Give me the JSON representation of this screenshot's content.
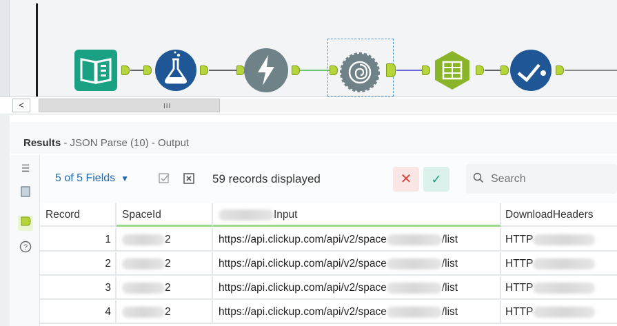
{
  "canvas": {
    "colors": {
      "book_tool": "#1aa083",
      "blue_tool": "#1f5796",
      "grey_tool": "#6f8288",
      "summarize_tool": "#8ab52a",
      "anchor": "#b5d53a",
      "selection": "#4a90c7"
    },
    "tools": [
      {
        "name": "input-data-icon",
        "color": "#1aa083"
      },
      {
        "name": "formula-icon",
        "color": "#1f5796"
      },
      {
        "name": "download-icon",
        "color": "#6f8288"
      },
      {
        "name": "json-parse-icon",
        "color": "#6f8288"
      },
      {
        "name": "summarize-icon",
        "color": "#8ab52a"
      },
      {
        "name": "browse-icon",
        "color": "#1f5796"
      }
    ]
  },
  "scrollbar": {
    "left_arrow": "<",
    "grip": "III"
  },
  "results": {
    "label": "Results",
    "title": " - JSON Parse (10) - Output",
    "fields_label": "5 of 5 Fields",
    "records_displayed": "59 records displayed",
    "search_placeholder": "Search",
    "columns": [
      "Record",
      "SpaceId",
      "Input",
      "DownloadHeaders"
    ],
    "rows": [
      {
        "record": "1",
        "spaceid_suffix": "2",
        "input": "https://api.clickup.com/api/v2/space",
        "input_suffix": "/list",
        "download": "HTTP"
      },
      {
        "record": "2",
        "spaceid_suffix": "2",
        "input": "https://api.clickup.com/api/v2/space",
        "input_suffix": "/list",
        "download": "HTTP"
      },
      {
        "record": "3",
        "spaceid_suffix": "2",
        "input": "https://api.clickup.com/api/v2/space",
        "input_suffix": "/list",
        "download": "HTTP"
      },
      {
        "record": "4",
        "spaceid_suffix": "2",
        "input": "https://api.clickup.com/api/v2/space",
        "input_suffix": "/list",
        "download": "HTTP"
      }
    ]
  },
  "colors": {
    "accent_blue": "#1f66b3",
    "cancel_red": "#d9423d",
    "apply_green": "#1a9a7c",
    "header_underline": "#9bd98a"
  }
}
